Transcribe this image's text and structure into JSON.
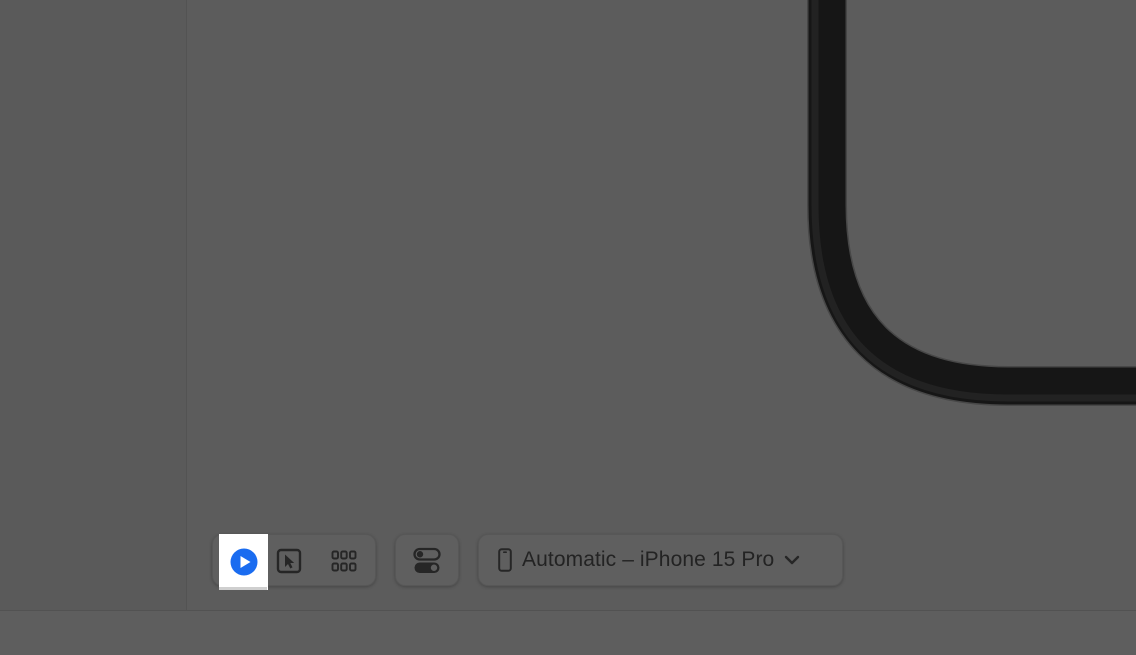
{
  "toolbar": {
    "modes": [
      {
        "name": "live",
        "icon": "play-circle-icon",
        "selected": true
      },
      {
        "name": "selectable",
        "icon": "cursor-select-icon",
        "selected": false
      },
      {
        "name": "variants-grid",
        "icon": "grid-icon",
        "selected": false
      }
    ],
    "variants_icon": "toggles-icon",
    "device_icon": "iphone-icon",
    "device_label": "Automatic – iPhone 15 Pro",
    "device_chevron": "chevron-down-icon"
  },
  "colors": {
    "accent": "#1a6cf0",
    "background": "#5c5c5c",
    "device_bezel": "#161616",
    "icon": "#262626"
  }
}
